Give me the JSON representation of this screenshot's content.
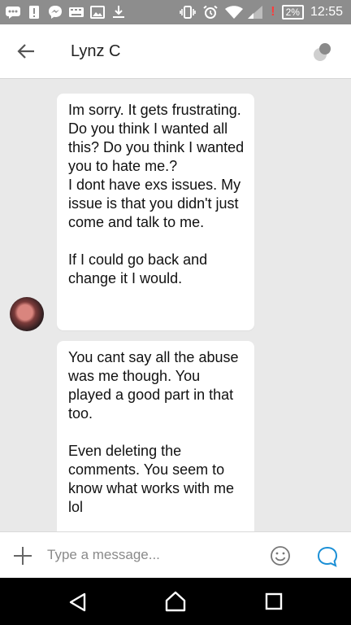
{
  "status_bar": {
    "battery_percent": "2%",
    "battery_alert": "!",
    "time": "12:55",
    "icons_left": [
      "chat-notification-icon",
      "alert-notification-icon",
      "messenger-icon",
      "keyboard-icon",
      "image-icon",
      "download-icon"
    ],
    "icons_right": [
      "vibrate-icon",
      "alarm-icon",
      "wifi-icon",
      "signal-icon",
      "battery-icon"
    ]
  },
  "header": {
    "title": "Lynz C",
    "back_icon": "arrow-left-icon",
    "menu_icon": "overflow-icon"
  },
  "messages": [
    {
      "sender": "Lynz C",
      "text": "Im sorry. It gets frustrating. Do you think I wanted all this? Do you think I wanted you to hate me.?\nI dont have exs issues. My issue is that you didn't just come and talk to me.\n\nIf I could go back and change it I would."
    },
    {
      "sender": "Lynz C",
      "text": "You cant say all the abuse was me though. You played a good part in that too.\n\nEven deleting the comments. You seem to know what works with me lol"
    }
  ],
  "composer": {
    "placeholder": "Type a message...",
    "value": ""
  },
  "colors": {
    "status_bar_bg": "#8d8d8d",
    "chat_bg": "#e9e9e9",
    "bubble_bg": "#ffffff",
    "accent": "#1a8fd6",
    "nav_bar_bg": "#000000"
  }
}
